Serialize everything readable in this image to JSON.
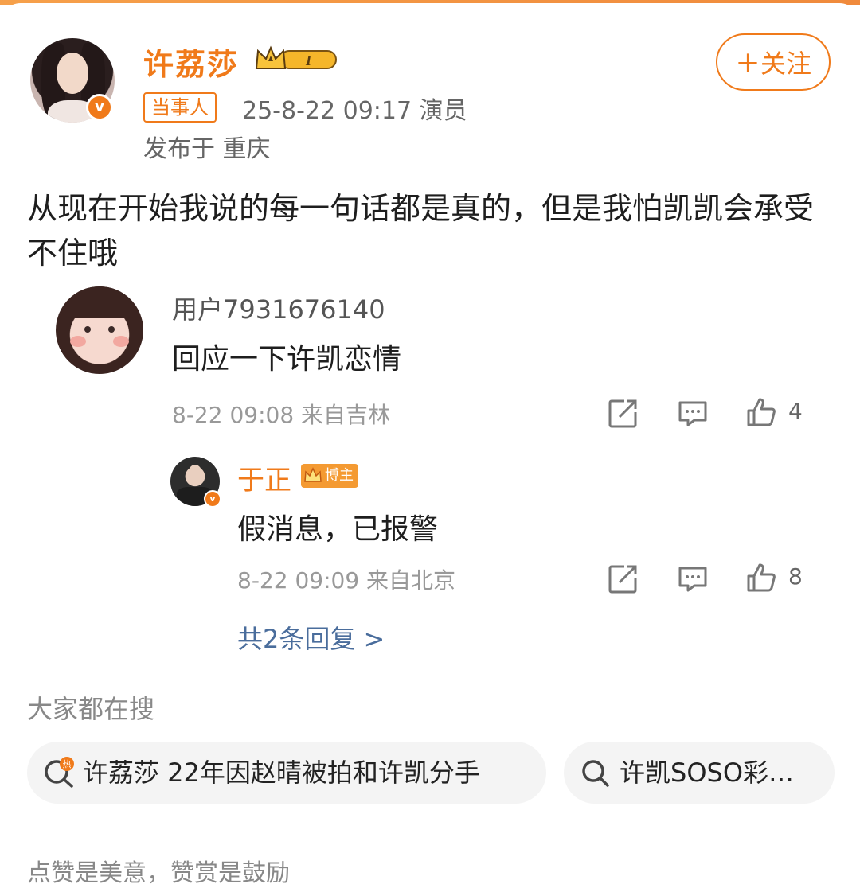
{
  "post": {
    "author_name": "许荔莎",
    "level_badge": "I",
    "follow_label": "＋关注",
    "role_tag": "当事人",
    "meta": "25-8-22 09:17  演员",
    "location": "发布于 重庆",
    "content": "从现在开始我说的每一句话都是真的，但是我怕凯凯会承受不住哦"
  },
  "comments": [
    {
      "user": "用户7931676140",
      "text": "回应一下许凯恋情",
      "meta": "8-22 09:08 来自吉林",
      "likes": "4"
    }
  ],
  "reply": {
    "user": "于正",
    "badge": "博主",
    "text": "假消息，已报警",
    "meta": "8-22 09:09 来自北京",
    "likes": "8"
  },
  "more_replies_label": "共2条回复 >",
  "search": {
    "title": "大家都在搜",
    "hot_badge": "热",
    "chips": [
      "许荔莎 22年因赵晴被拍和许凯分手",
      "许凯SOSO彩…"
    ]
  },
  "footer_text": "点赞是美意，赞赏是鼓励",
  "colors": {
    "accent": "#f07a1a",
    "link": "#4a6d9c",
    "gray": "#999999"
  }
}
